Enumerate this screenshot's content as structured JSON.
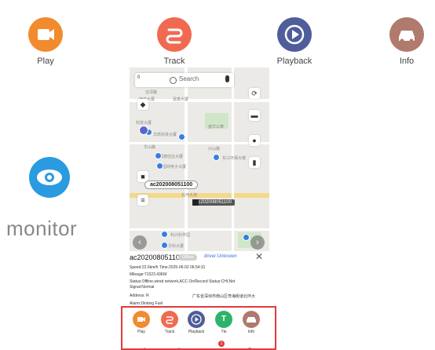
{
  "features": [
    {
      "label": "Play",
      "color": "#f28a2e",
      "icon": "video-camera-icon"
    },
    {
      "label": "Track",
      "color": "#f06a52",
      "icon": "route-icon"
    },
    {
      "label": "Playback",
      "color": "#4f5d9b",
      "icon": "playback-icon"
    },
    {
      "label": "Info",
      "color": "#b07a6c",
      "icon": "car-icon"
    }
  ],
  "monitor": {
    "label": "monitor",
    "color": "#2a9be0",
    "icon": "eye-icon"
  },
  "search": {
    "prefix": "0",
    "placeholder": "Search"
  },
  "map": {
    "texts": [
      "宝深路",
      "海文大厦",
      "嘉泰大厦",
      "科技大厦",
      "华山路",
      "兴山路",
      "华凯科技大厦",
      "源德创业大厦",
      "招商电子大厦",
      "东江环保大楼",
      "北环大道",
      "科兴科学园",
      "利华科大厦",
      "盛华公寓"
    ],
    "vehicle_label": "ac202008051100",
    "vehicle_dark_label": "ac202008051100"
  },
  "info": {
    "title": "ac202008051100",
    "badge": "Offline",
    "driver": "driver:Unknown",
    "speed_line": "Speed:22.0km/h   Time:2025-06-02 06:54:31",
    "mileage_line": "Mileage:71523.43KM",
    "status_line": "Status:Offline,wired network,ACC On/Record Status:CHI,Net",
    "signal_line": "Signal:Normal",
    "address_label": "Address: R",
    "address_value": "广东省深圳市南山区粤海街道北环大",
    "alarm_line": "Alarm:Dinking Fuel"
  },
  "bottom_actions": [
    {
      "label": "Play",
      "color": "#f28a2e",
      "icon": "video-camera-icon"
    },
    {
      "label": "Track",
      "color": "#f06a52",
      "icon": "route-icon"
    },
    {
      "label": "Playback",
      "color": "#4f5d9b",
      "icon": "playback-icon"
    },
    {
      "label": "Tts",
      "color": "#2db36a",
      "icon": "tts-icon",
      "glyph": "T"
    },
    {
      "label": "Info",
      "color": "#b07a6c",
      "icon": "car-icon"
    }
  ],
  "bottom_nav": [
    "home-icon",
    "eye-icon",
    "alarm-icon",
    "user-icon"
  ],
  "nav_badge": "1"
}
